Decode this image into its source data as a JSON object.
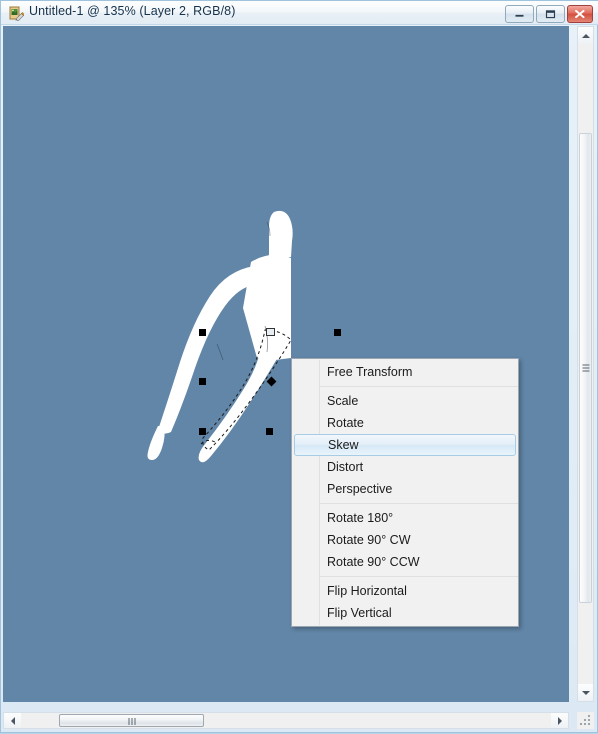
{
  "window": {
    "title": "Untitled-1 @ 135% (Layer 2, RGB/8)",
    "icon": "document-pencil-icon",
    "controls": {
      "minimize_label": "Minimize",
      "maximize_label": "Maximize",
      "close_label": "Close"
    }
  },
  "canvas": {
    "background_color": "#6286a8",
    "layer_color": "#ffffff",
    "zoom_level": "135%",
    "layer_name": "Layer 2",
    "color_mode": "RGB/8"
  },
  "transform": {
    "handles_label": "transform-handle",
    "pivot_label": "transform-pivot-point"
  },
  "context_menu": {
    "groups": [
      {
        "items": [
          {
            "label": "Free Transform",
            "selected": false
          }
        ]
      },
      {
        "items": [
          {
            "label": "Scale",
            "selected": false
          },
          {
            "label": "Rotate",
            "selected": false
          },
          {
            "label": "Skew",
            "selected": true
          },
          {
            "label": "Distort",
            "selected": false
          },
          {
            "label": "Perspective",
            "selected": false
          }
        ]
      },
      {
        "items": [
          {
            "label": "Rotate 180°",
            "selected": false
          },
          {
            "label": "Rotate 90° CW",
            "selected": false
          },
          {
            "label": "Rotate 90° CCW",
            "selected": false
          }
        ]
      },
      {
        "items": [
          {
            "label": "Flip Horizontal",
            "selected": false
          },
          {
            "label": "Flip Vertical",
            "selected": false
          }
        ]
      }
    ]
  },
  "scrollbars": {
    "vertical": {
      "up_label": "Scroll up",
      "down_label": "Scroll down"
    },
    "horizontal": {
      "left_label": "Scroll left",
      "right_label": "Scroll right"
    }
  },
  "colors": {
    "canvas": "#6286a8",
    "menu_background": "#f1f1f1",
    "menu_highlight": "#d5e8f6",
    "menu_highlight_border": "#a8cce4",
    "title_text": "#16334d",
    "close_button": "#d24f3e"
  }
}
